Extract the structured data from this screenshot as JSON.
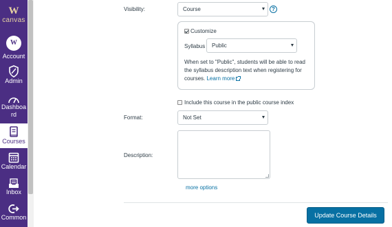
{
  "nav": {
    "logo_mark": "W",
    "logo_text": "canvas",
    "avatar_initial": "W",
    "items": [
      {
        "label": "Account",
        "icon": "user-avatar"
      },
      {
        "label": "Admin",
        "icon": "shield-icon"
      },
      {
        "label": "Dashboa\nrd",
        "icon": "speedometer-icon"
      },
      {
        "label": "Courses",
        "icon": "book-icon"
      },
      {
        "label": "Calendar",
        "icon": "calendar-icon"
      },
      {
        "label": "Inbox",
        "icon": "inbox-icon"
      },
      {
        "label": "Common",
        "icon": "share-arrow-icon"
      }
    ],
    "active_item": "Courses",
    "colors": {
      "background": "#4b2e83",
      "logo": "#e8d3a2",
      "active_text": "#4b2e83"
    }
  },
  "form": {
    "visibility_label": "Visibility:",
    "visibility_value": "Course",
    "help_icon": "?",
    "customize_label": "Customize",
    "customize_checked": true,
    "syllabus_label": "Syllabus",
    "syllabus_value": "Public",
    "syllabus_help": "When set to \"Public\", students will be able to read the syllabus description text when registering for courses.",
    "learn_more_label": "Learn more",
    "public_index_label": "Include this course in the public course index",
    "public_index_checked": false,
    "format_label": "Format:",
    "format_value": "Not Set",
    "description_label": "Description:",
    "description_value": "",
    "more_options_label": "more options",
    "submit_label": "Update Course Details"
  },
  "colors": {
    "link": "#0770a3",
    "primary_button": "#0770a3",
    "text": "#2d3b45"
  }
}
